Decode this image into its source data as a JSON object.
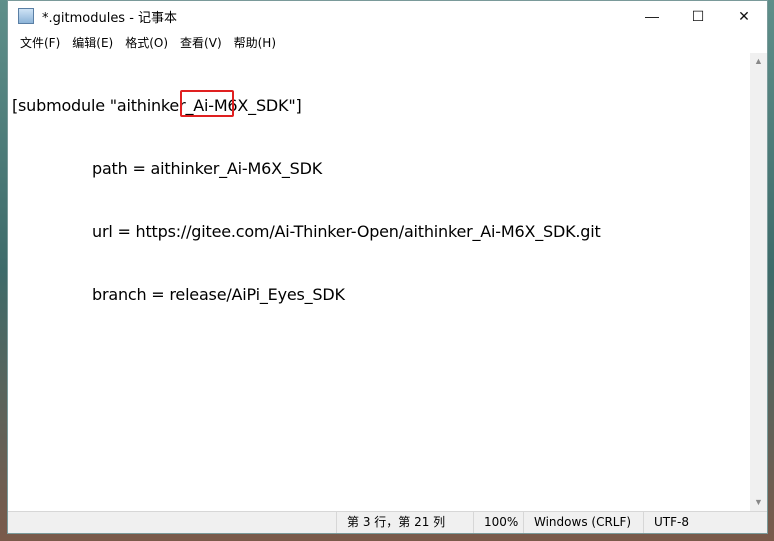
{
  "window": {
    "title": "*.gitmodules - 记事本",
    "minimize": "—",
    "maximize": "☐",
    "close": "✕"
  },
  "menu": [
    "文件(F)",
    "编辑(E)",
    "格式(O)",
    "查看(V)",
    "帮助(H)"
  ],
  "content": {
    "lines": [
      {
        "indent": false,
        "text": "[submodule \"aithinker_Ai-M6X_SDK\"]"
      },
      {
        "indent": true,
        "text": "path = aithinker_Ai-M6X_SDK"
      },
      {
        "indent": true,
        "text": "url = https://gitee.com/Ai-Thinker-Open/aithinker_Ai-M6X_SDK.git"
      },
      {
        "indent": true,
        "text": "branch = release/AiPi_Eyes_SDK"
      }
    ],
    "highlight_color": "#e02020"
  },
  "status": {
    "position": "第 3 行，第 21 列",
    "zoom": "100%",
    "line_ending": "Windows (CRLF)",
    "encoding": "UTF-8"
  },
  "scroll": {
    "up": "▲",
    "down": "▼"
  }
}
